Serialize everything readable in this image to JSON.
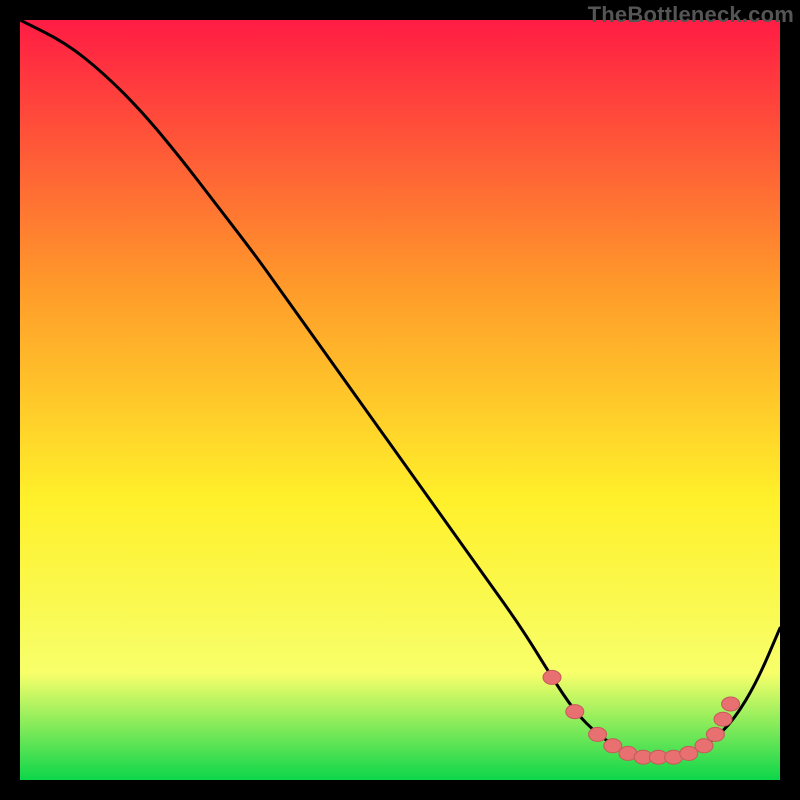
{
  "watermark": "TheBottleneck.com",
  "colors": {
    "frame": "#000000",
    "gradient_top": "#ff1c44",
    "gradient_mid1": "#ff9a2a",
    "gradient_mid2": "#fff02a",
    "gradient_mid3": "#f7ff6a",
    "gradient_bottom": "#0dd64a",
    "curve": "#000000",
    "dot_fill": "#e87070",
    "dot_stroke": "#c55a5a"
  },
  "chart_data": {
    "type": "line",
    "title": "",
    "xlabel": "",
    "ylabel": "",
    "xlim": [
      0,
      100
    ],
    "ylim": [
      0,
      100
    ],
    "series": [
      {
        "name": "curve",
        "x": [
          0,
          6,
          11,
          16,
          21,
          26,
          31,
          36,
          41,
          46,
          51,
          56,
          61,
          66,
          70,
          73,
          76,
          79,
          82,
          85,
          88,
          91,
          94,
          97,
          100
        ],
        "values": [
          100,
          97,
          93,
          88,
          82,
          75.5,
          69,
          62,
          55,
          48,
          41,
          34,
          27,
          20,
          13.5,
          9,
          6,
          4,
          3,
          3,
          3.5,
          5,
          8,
          13,
          20
        ]
      }
    ],
    "dots": [
      {
        "x": 70,
        "y": 13.5
      },
      {
        "x": 73,
        "y": 9
      },
      {
        "x": 76,
        "y": 6
      },
      {
        "x": 78,
        "y": 4.5
      },
      {
        "x": 80,
        "y": 3.5
      },
      {
        "x": 82,
        "y": 3
      },
      {
        "x": 84,
        "y": 3
      },
      {
        "x": 86,
        "y": 3
      },
      {
        "x": 88,
        "y": 3.5
      },
      {
        "x": 90,
        "y": 4.5
      },
      {
        "x": 91.5,
        "y": 6
      },
      {
        "x": 92.5,
        "y": 8
      },
      {
        "x": 93.5,
        "y": 10
      }
    ]
  }
}
